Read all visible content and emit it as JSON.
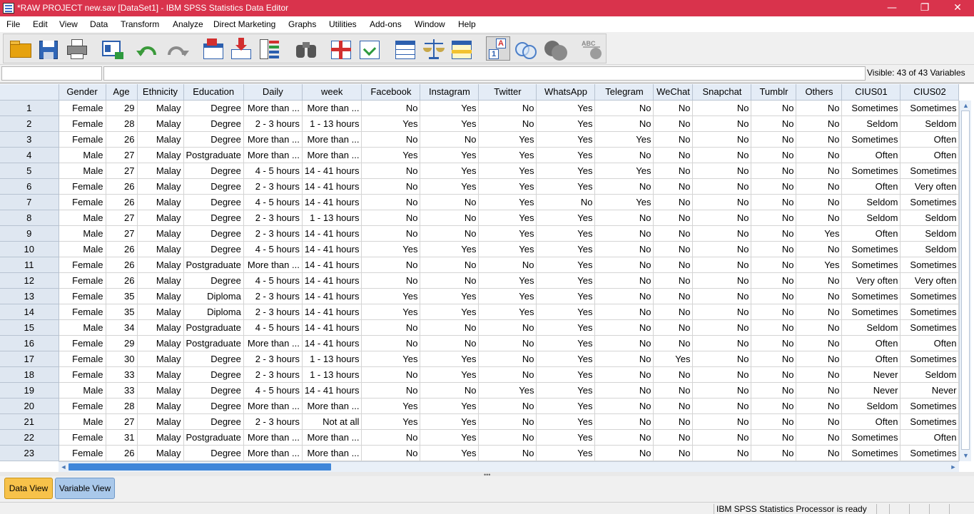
{
  "window": {
    "title": "*RAW PROJECT new.sav [DataSet1] - IBM SPSS Statistics Data Editor",
    "minimize_glyph": "—",
    "restore_glyph": "❐",
    "close_glyph": "✕",
    "accent_color": "#d9334c"
  },
  "menu": [
    "File",
    "Edit",
    "View",
    "Data",
    "Transform",
    "Analyze",
    "Direct Marketing",
    "Graphs",
    "Utilities",
    "Add-ons",
    "Window",
    "Help"
  ],
  "toolbar_icons": [
    "open-folder-icon",
    "save-icon",
    "print-icon",
    "recall-dialog-icon",
    "undo-icon",
    "redo-icon",
    "goto-case-icon",
    "goto-variable-icon",
    "variables-icon",
    "find-icon",
    "insert-cases-icon",
    "insert-variable-icon",
    "split-file-icon",
    "weight-cases-icon",
    "select-cases-icon",
    "value-labels-icon",
    "use-variable-sets-icon",
    "show-all-variables-icon",
    "spell-check-icon"
  ],
  "cellbar": {
    "cell_reference": "",
    "cell_value": "",
    "visible_variables": "Visible: 43 of 43 Variables"
  },
  "grid": {
    "columns": [
      "Gender",
      "Age",
      "Ethnicity",
      "Education",
      "Daily",
      "week",
      "Facebook",
      "Instagram",
      "Twitter",
      "WhatsApp",
      "Telegram",
      "WeChat",
      "Snapchat",
      "Tumblr",
      "Others",
      "CIUS01",
      "CIUS02"
    ],
    "rows": [
      [
        "1",
        "Female",
        "29",
        "Malay",
        "Degree",
        "More than ...",
        "More than ...",
        "No",
        "Yes",
        "No",
        "Yes",
        "No",
        "No",
        "No",
        "No",
        "No",
        "Sometimes",
        "Sometimes"
      ],
      [
        "2",
        "Female",
        "28",
        "Malay",
        "Degree",
        "2 - 3 hours",
        "1 - 13 hours",
        "Yes",
        "Yes",
        "No",
        "Yes",
        "No",
        "No",
        "No",
        "No",
        "No",
        "Seldom",
        "Seldom"
      ],
      [
        "3",
        "Female",
        "26",
        "Malay",
        "Degree",
        "More than ...",
        "More than ...",
        "No",
        "No",
        "Yes",
        "Yes",
        "Yes",
        "No",
        "No",
        "No",
        "No",
        "Sometimes",
        "Often"
      ],
      [
        "4",
        "Male",
        "27",
        "Malay",
        "Postgraduate",
        "More than ...",
        "More than ...",
        "Yes",
        "Yes",
        "Yes",
        "Yes",
        "No",
        "No",
        "No",
        "No",
        "No",
        "Often",
        "Often"
      ],
      [
        "5",
        "Male",
        "27",
        "Malay",
        "Degree",
        "4 - 5 hours",
        "14 - 41 hours",
        "No",
        "Yes",
        "Yes",
        "Yes",
        "Yes",
        "No",
        "No",
        "No",
        "No",
        "Sometimes",
        "Sometimes"
      ],
      [
        "6",
        "Female",
        "26",
        "Malay",
        "Degree",
        "2 - 3 hours",
        "14 - 41 hours",
        "No",
        "Yes",
        "Yes",
        "Yes",
        "No",
        "No",
        "No",
        "No",
        "No",
        "Often",
        "Very often"
      ],
      [
        "7",
        "Female",
        "26",
        "Malay",
        "Degree",
        "4 - 5 hours",
        "14 - 41 hours",
        "No",
        "No",
        "Yes",
        "No",
        "Yes",
        "No",
        "No",
        "No",
        "No",
        "Seldom",
        "Sometimes"
      ],
      [
        "8",
        "Male",
        "27",
        "Malay",
        "Degree",
        "2 - 3 hours",
        "1 - 13 hours",
        "No",
        "No",
        "Yes",
        "Yes",
        "No",
        "No",
        "No",
        "No",
        "No",
        "Seldom",
        "Seldom"
      ],
      [
        "9",
        "Male",
        "27",
        "Malay",
        "Degree",
        "2 - 3 hours",
        "14 - 41 hours",
        "No",
        "No",
        "Yes",
        "Yes",
        "No",
        "No",
        "No",
        "No",
        "Yes",
        "Often",
        "Seldom"
      ],
      [
        "10",
        "Male",
        "26",
        "Malay",
        "Degree",
        "4 - 5 hours",
        "14 - 41 hours",
        "Yes",
        "Yes",
        "Yes",
        "Yes",
        "No",
        "No",
        "No",
        "No",
        "No",
        "Sometimes",
        "Seldom"
      ],
      [
        "11",
        "Female",
        "26",
        "Malay",
        "Postgraduate",
        "More than ...",
        "14 - 41 hours",
        "No",
        "No",
        "No",
        "Yes",
        "No",
        "No",
        "No",
        "No",
        "Yes",
        "Sometimes",
        "Sometimes"
      ],
      [
        "12",
        "Female",
        "26",
        "Malay",
        "Degree",
        "4 - 5 hours",
        "14 - 41 hours",
        "No",
        "No",
        "Yes",
        "Yes",
        "No",
        "No",
        "No",
        "No",
        "No",
        "Very often",
        "Very often"
      ],
      [
        "13",
        "Female",
        "35",
        "Malay",
        "Diploma",
        "2 - 3 hours",
        "14 - 41 hours",
        "Yes",
        "Yes",
        "Yes",
        "Yes",
        "No",
        "No",
        "No",
        "No",
        "No",
        "Sometimes",
        "Sometimes"
      ],
      [
        "14",
        "Female",
        "35",
        "Malay",
        "Diploma",
        "2 - 3 hours",
        "14 - 41 hours",
        "Yes",
        "Yes",
        "Yes",
        "Yes",
        "No",
        "No",
        "No",
        "No",
        "No",
        "Sometimes",
        "Sometimes"
      ],
      [
        "15",
        "Male",
        "34",
        "Malay",
        "Postgraduate",
        "4 - 5 hours",
        "14 - 41 hours",
        "No",
        "No",
        "No",
        "Yes",
        "No",
        "No",
        "No",
        "No",
        "No",
        "Seldom",
        "Sometimes"
      ],
      [
        "16",
        "Female",
        "29",
        "Malay",
        "Postgraduate",
        "More than ...",
        "14 - 41 hours",
        "No",
        "No",
        "No",
        "Yes",
        "No",
        "No",
        "No",
        "No",
        "No",
        "Often",
        "Often"
      ],
      [
        "17",
        "Female",
        "30",
        "Malay",
        "Degree",
        "2 - 3 hours",
        "1 - 13 hours",
        "Yes",
        "Yes",
        "No",
        "Yes",
        "No",
        "Yes",
        "No",
        "No",
        "No",
        "Often",
        "Sometimes"
      ],
      [
        "18",
        "Female",
        "33",
        "Malay",
        "Degree",
        "2 - 3 hours",
        "1 - 13 hours",
        "No",
        "Yes",
        "No",
        "Yes",
        "No",
        "No",
        "No",
        "No",
        "No",
        "Never",
        "Seldom"
      ],
      [
        "19",
        "Male",
        "33",
        "Malay",
        "Degree",
        "4 - 5 hours",
        "14 - 41 hours",
        "No",
        "No",
        "Yes",
        "Yes",
        "No",
        "No",
        "No",
        "No",
        "No",
        "Never",
        "Never"
      ],
      [
        "20",
        "Female",
        "28",
        "Malay",
        "Degree",
        "More than ...",
        "More than ...",
        "Yes",
        "Yes",
        "No",
        "Yes",
        "No",
        "No",
        "No",
        "No",
        "No",
        "Seldom",
        "Sometimes"
      ],
      [
        "21",
        "Male",
        "27",
        "Malay",
        "Degree",
        "2 - 3 hours",
        "Not at all",
        "Yes",
        "Yes",
        "No",
        "Yes",
        "No",
        "No",
        "No",
        "No",
        "No",
        "Often",
        "Sometimes"
      ],
      [
        "22",
        "Female",
        "31",
        "Malay",
        "Postgraduate",
        "More than ...",
        "More than ...",
        "No",
        "Yes",
        "No",
        "Yes",
        "No",
        "No",
        "No",
        "No",
        "No",
        "Sometimes",
        "Often"
      ],
      [
        "23",
        "Female",
        "26",
        "Malay",
        "Degree",
        "More than ...",
        "More than ...",
        "No",
        "Yes",
        "No",
        "Yes",
        "No",
        "No",
        "No",
        "No",
        "No",
        "Sometimes",
        "Sometimes"
      ]
    ]
  },
  "scroll_glyphs": {
    "up": "▲",
    "down": "▼",
    "left": "◄",
    "right": "►",
    "grip": "•••"
  },
  "tabs": [
    {
      "label": "Data View",
      "active": true,
      "color": "#f7c24a"
    },
    {
      "label": "Variable View",
      "active": false,
      "color": "#a9c8ea"
    }
  ],
  "status": {
    "text": "IBM SPSS Statistics Processor is ready"
  }
}
